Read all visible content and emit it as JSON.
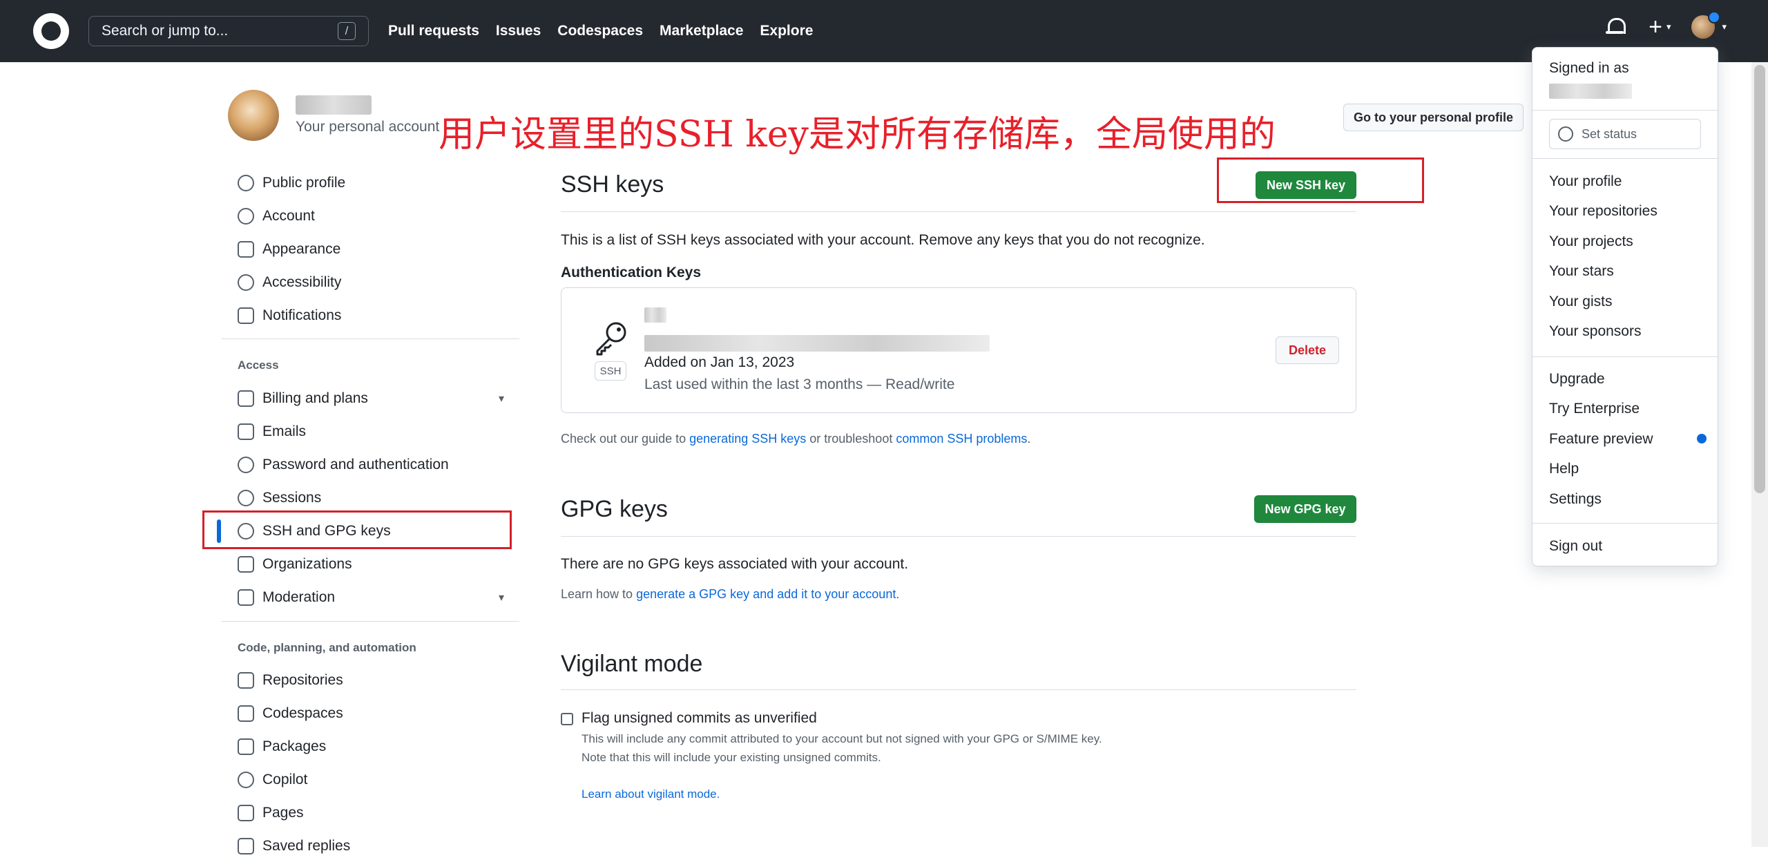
{
  "topbar": {
    "search_placeholder": "Search or jump to...",
    "search_shortcut": "/",
    "nav": [
      "Pull requests",
      "Issues",
      "Codespaces",
      "Marketplace",
      "Explore"
    ],
    "plus": "+",
    "caret": "▾"
  },
  "profile": {
    "personal_account": "Your personal account",
    "goto_profile": "Go to your personal profile"
  },
  "annotation": "用户设置里的SSH key是对所有存储库，全局使用的",
  "sidebar": {
    "items_top": [
      "Public profile",
      "Account",
      "Appearance",
      "Accessibility",
      "Notifications"
    ],
    "access_heading": "Access",
    "items_access": [
      "Billing and plans",
      "Emails",
      "Password and authentication",
      "Sessions",
      "SSH and GPG keys",
      "Organizations",
      "Moderation"
    ],
    "code_heading": "Code, planning, and automation",
    "items_code": [
      "Repositories",
      "Codespaces",
      "Packages",
      "Copilot",
      "Pages",
      "Saved replies"
    ]
  },
  "ssh": {
    "title": "SSH keys",
    "new_button": "New SSH key",
    "description": "This is a list of SSH keys associated with your account. Remove any keys that you do not recognize.",
    "auth_heading": "Authentication Keys",
    "badge": "SSH",
    "added": "Added on Jan 13, 2023",
    "last_used": "Last used within the last 3 months — Read/write",
    "delete": "Delete",
    "guide_prefix": "Check out our guide to",
    "guide_link1": "generating SSH keys",
    "guide_middle": "or troubleshoot",
    "guide_link2": "common SSH problems",
    "guide_suffix": "."
  },
  "gpg": {
    "title": "GPG keys",
    "new_button": "New GPG key",
    "none": "There are no GPG keys associated with your account.",
    "learn_prefix": "Learn how to",
    "learn_link": "generate a GPG key and add it to your account",
    "learn_suffix": "."
  },
  "vigilant": {
    "title": "Vigilant mode",
    "checkbox_label": "Flag unsigned commits as unverified",
    "note1": "This will include any commit attributed to your account but not signed with your GPG or S/MIME key.",
    "note2": "Note that this will include your existing unsigned commits.",
    "learn_link": "Learn about vigilant mode."
  },
  "dropdown": {
    "signed_in_as": "Signed in as",
    "set_status": "Set status",
    "group1": [
      "Your profile",
      "Your repositories",
      "Your projects",
      "Your stars",
      "Your gists",
      "Your sponsors"
    ],
    "group2": [
      "Upgrade",
      "Try Enterprise",
      "Feature preview",
      "Help",
      "Settings"
    ],
    "sign_out": "Sign out"
  },
  "colors": {
    "topbar": "#24292f",
    "accent_green": "#1f883d",
    "link_blue": "#0969da",
    "annotation_red": "#e8202a",
    "highlight_box_red": "#d3202a"
  }
}
